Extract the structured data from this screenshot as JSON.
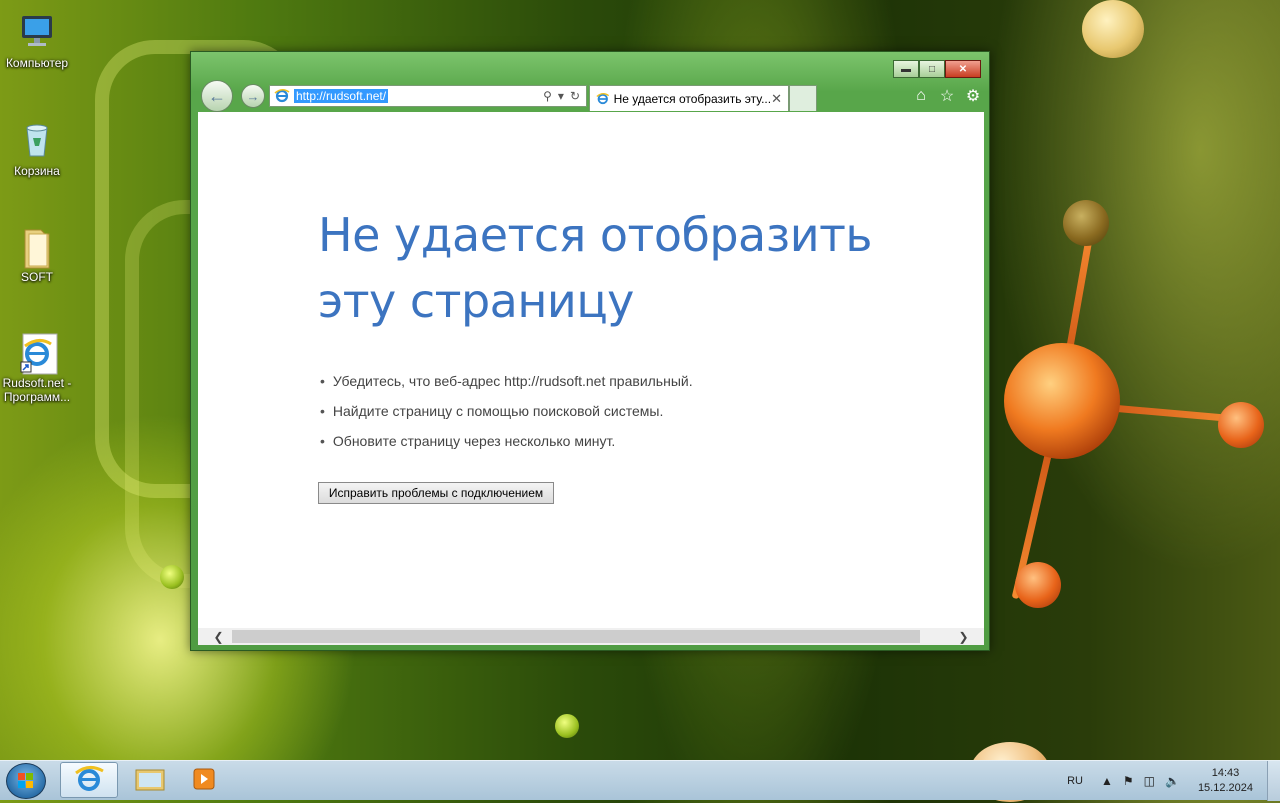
{
  "desktop": {
    "icons": [
      {
        "label": "Компьютер"
      },
      {
        "label": "Корзина"
      },
      {
        "label": "SOFT"
      },
      {
        "label": "Rudsoft.net - Программ..."
      }
    ]
  },
  "browser": {
    "address_url": "http://rudsoft.net/",
    "tab_title": "Не удается отобразить эту...",
    "page": {
      "title": "Не удается отобразить эту страницу",
      "suggestions": [
        "Убедитесь, что веб-адрес http://rudsoft.net правильный.",
        "Найдите страницу с помощью поисковой системы.",
        "Обновите страницу через несколько минут."
      ],
      "fix_button": "Исправить проблемы с подключением"
    }
  },
  "taskbar": {
    "language": "RU",
    "time": "14:43",
    "date": "15.12.2024"
  }
}
